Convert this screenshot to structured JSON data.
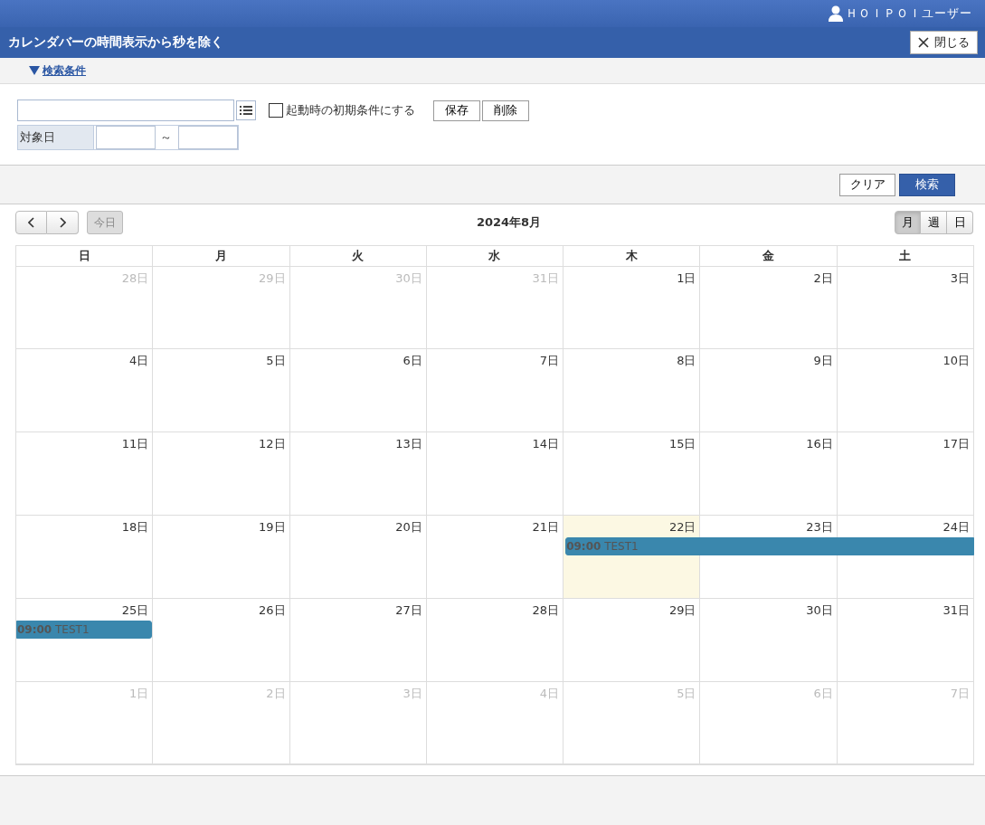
{
  "header": {
    "user": "ＨＯＩＰＯＩユーザー",
    "title": "カレンダバーの時間表示から秒を除く",
    "close_button": "閉じる"
  },
  "search_conditions": {
    "toggle": "検索条件",
    "expanded": true,
    "default_checkbox": {
      "label": "起動時の初期条件にする",
      "checked": false
    },
    "save_button": "保存",
    "delete_button": "削除",
    "date_label": "対象日",
    "range_separator": "～"
  },
  "action_buttons": [
    {
      "label": "クリア",
      "kind": "secondary"
    },
    {
      "label": "検索",
      "kind": "primary"
    }
  ],
  "calendar": {
    "title": "2024年8月",
    "today_button": {
      "label": "今日",
      "disabled": true
    },
    "views": [
      {
        "label": "月",
        "selected": true
      },
      {
        "label": "週",
        "selected": false
      },
      {
        "label": "日",
        "selected": false
      }
    ],
    "weekdays": [
      "日",
      "月",
      "火",
      "水",
      "木",
      "金",
      "土"
    ],
    "weeks": [
      {
        "days": [
          {
            "label": "28日",
            "other_month": true,
            "today": false
          },
          {
            "label": "29日",
            "other_month": true,
            "today": false
          },
          {
            "label": "30日",
            "other_month": true,
            "today": false
          },
          {
            "label": "31日",
            "other_month": true,
            "today": false
          },
          {
            "label": "1日",
            "other_month": false,
            "today": false
          },
          {
            "label": "2日",
            "other_month": false,
            "today": false
          },
          {
            "label": "3日",
            "other_month": false,
            "today": false
          }
        ]
      },
      {
        "days": [
          {
            "label": "4日",
            "other_month": false,
            "today": false
          },
          {
            "label": "5日",
            "other_month": false,
            "today": false
          },
          {
            "label": "6日",
            "other_month": false,
            "today": false
          },
          {
            "label": "7日",
            "other_month": false,
            "today": false
          },
          {
            "label": "8日",
            "other_month": false,
            "today": false
          },
          {
            "label": "9日",
            "other_month": false,
            "today": false
          },
          {
            "label": "10日",
            "other_month": false,
            "today": false
          }
        ]
      },
      {
        "days": [
          {
            "label": "11日",
            "other_month": false,
            "today": false
          },
          {
            "label": "12日",
            "other_month": false,
            "today": false
          },
          {
            "label": "13日",
            "other_month": false,
            "today": false
          },
          {
            "label": "14日",
            "other_month": false,
            "today": false
          },
          {
            "label": "15日",
            "other_month": false,
            "today": false
          },
          {
            "label": "16日",
            "other_month": false,
            "today": false
          },
          {
            "label": "17日",
            "other_month": false,
            "today": false
          }
        ]
      },
      {
        "days": [
          {
            "label": "18日",
            "other_month": false,
            "today": false
          },
          {
            "label": "19日",
            "other_month": false,
            "today": false
          },
          {
            "label": "20日",
            "other_month": false,
            "today": false
          },
          {
            "label": "21日",
            "other_month": false,
            "today": false
          },
          {
            "label": "22日",
            "other_month": false,
            "today": true,
            "events": [
              {
                "time": "09:00",
                "title": "TEST1",
                "continues_before": false,
                "continues_after": true
              }
            ]
          },
          {
            "label": "23日",
            "other_month": false,
            "today": false
          },
          {
            "label": "24日",
            "other_month": false,
            "today": false
          }
        ]
      },
      {
        "days": [
          {
            "label": "25日",
            "other_month": false,
            "today": false,
            "events": [
              {
                "time": "09:00",
                "title": "TEST1",
                "continues_before": true,
                "continues_after": false
              }
            ]
          },
          {
            "label": "26日",
            "other_month": false,
            "today": false
          },
          {
            "label": "27日",
            "other_month": false,
            "today": false
          },
          {
            "label": "28日",
            "other_month": false,
            "today": false
          },
          {
            "label": "29日",
            "other_month": false,
            "today": false
          },
          {
            "label": "30日",
            "other_month": false,
            "today": false
          },
          {
            "label": "31日",
            "other_month": false,
            "today": false
          }
        ]
      },
      {
        "days": [
          {
            "label": "1日",
            "other_month": true,
            "today": false
          },
          {
            "label": "2日",
            "other_month": true,
            "today": false
          },
          {
            "label": "3日",
            "other_month": true,
            "today": false
          },
          {
            "label": "4日",
            "other_month": true,
            "today": false
          },
          {
            "label": "5日",
            "other_month": true,
            "today": false
          },
          {
            "label": "6日",
            "other_month": true,
            "today": false
          },
          {
            "label": "7日",
            "other_month": true,
            "today": false
          }
        ]
      }
    ]
  }
}
